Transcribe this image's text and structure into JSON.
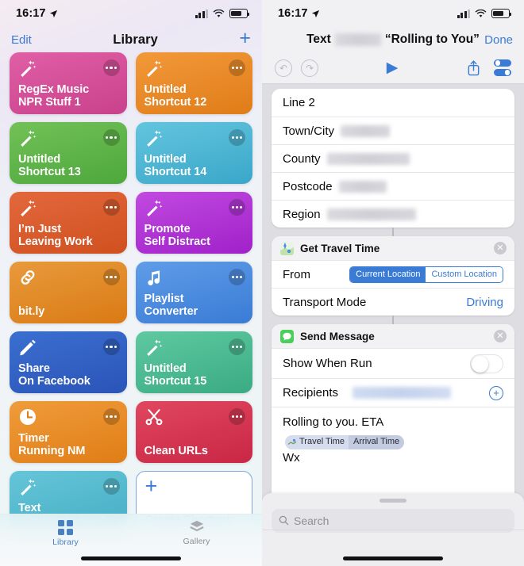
{
  "status_bar": {
    "time": "16:17",
    "location_arrow": "location-arrow",
    "signal": "cellular-bars",
    "wifi": "wifi-icon",
    "battery": "battery-icon"
  },
  "left_pane": {
    "nav": {
      "edit_label": "Edit",
      "title": "Library",
      "add_label": "+"
    },
    "shortcuts": [
      {
        "name": "RegEx Music\nNPR Stuff 1",
        "icon": "magic-wand-icon",
        "color_top": "#e05fa5",
        "color_bottom": "#c9418c"
      },
      {
        "name": "Untitled\nShortcut 12",
        "icon": "magic-wand-icon",
        "color_top": "#f2993a",
        "color_bottom": "#e07c18"
      },
      {
        "name": "Untitled\nShortcut 13",
        "icon": "magic-wand-icon",
        "color_top": "#72c157",
        "color_bottom": "#4da83c"
      },
      {
        "name": "Untitled\nShortcut 14",
        "icon": "magic-wand-icon",
        "color_top": "#63c5de",
        "color_bottom": "#3aa7c9"
      },
      {
        "name": "I’m Just\nLeaving Work",
        "icon": "magic-wand-icon",
        "color_top": "#e2683c",
        "color_bottom": "#d0501f"
      },
      {
        "name": "Promote\nSelf Distract",
        "icon": "magic-wand-icon",
        "color_top": "#c14ae0",
        "color_bottom": "#a021c9"
      },
      {
        "name": "bit.ly",
        "icon": "link-icon",
        "color_top": "#e89a3c",
        "color_bottom": "#da7a14"
      },
      {
        "name": "Playlist\nConverter",
        "icon": "music-note-icon",
        "color_top": "#5f9de8",
        "color_bottom": "#3a7bd5"
      },
      {
        "name": "Share\nOn Facebook",
        "icon": "pencil-icon",
        "color_top": "#3a6fd0",
        "color_bottom": "#2b54b8"
      },
      {
        "name": "Untitled\nShortcut 15",
        "icon": "magic-wand-icon",
        "color_top": "#5fc9a0",
        "color_bottom": "#3aab84"
      },
      {
        "name": "Timer\nRunning NM",
        "icon": "clock-icon",
        "color_top": "#ef9c3a",
        "color_bottom": "#e07d16"
      },
      {
        "name": "Clean URLs",
        "icon": "scissors-icon",
        "color_top": "#e0475f",
        "color_bottom": "#c92745"
      },
      {
        "name": "Text\n“Rolling to You”",
        "icon": "magic-wand-icon",
        "color_top": "#66c5d8",
        "color_bottom": "#45aec4"
      }
    ],
    "create_tile": {
      "plus": "+",
      "label": "Create Shortcut",
      "icon": "plus-icon"
    },
    "tabs": [
      {
        "label": "Library",
        "icon": "grid-squares-icon",
        "active": true
      },
      {
        "label": "Gallery",
        "icon": "layers-icon",
        "active": false
      }
    ]
  },
  "right_pane": {
    "header": {
      "title_prefix": "Text",
      "title_quoted": "“Rolling to You”",
      "redacted": true,
      "done_label": "Done"
    },
    "toolbar": {
      "undo": "undo-icon",
      "redo": "redo-icon",
      "run": "play-icon",
      "share": "share-icon",
      "settings": "toggles-icon"
    },
    "address_card": {
      "rows": [
        {
          "label": "Line 2",
          "value": "",
          "redacted": false,
          "redact_width": 0
        },
        {
          "label": "Town/City",
          "value": "",
          "redacted": true,
          "redact_width": 62
        },
        {
          "label": "County",
          "value": "",
          "redacted": true,
          "redact_width": 104
        },
        {
          "label": "Postcode",
          "value": "",
          "redacted": true,
          "redact_width": 60
        },
        {
          "label": "Region",
          "value": "",
          "redacted": true,
          "redact_width": 112
        }
      ]
    },
    "travel_card": {
      "title": "Get Travel Time",
      "icon": "maps-app-icon",
      "close": "close-icon",
      "from_label": "From",
      "from_options": [
        "Current Location",
        "Custom Location"
      ],
      "from_selected": "Current Location",
      "transport_label": "Transport Mode",
      "transport_value": "Driving"
    },
    "message_card": {
      "title": "Send Message",
      "icon": "messages-app-icon",
      "close": "close-icon",
      "show_when_run_label": "Show When Run",
      "show_when_run_on": false,
      "recipients_label": "Recipients",
      "recipients_redacted": true,
      "add_recipient": "+",
      "message_text": "Rolling to you. ETA",
      "message_tail": "Wx",
      "token": {
        "icon": "travel-icon",
        "segment_1": "Travel Time",
        "segment_2": "Arrival Time"
      }
    },
    "search_sheet": {
      "grabber": "drag-handle",
      "icon": "search-icon",
      "placeholder": "Search"
    }
  },
  "colors": {
    "accent_blue": "#3a7bd5",
    "tab_active": "#4a7fc1",
    "tab_idle": "#8e8e93",
    "card_bg": "#ffffff",
    "canvas_bg": "#dddde2"
  }
}
